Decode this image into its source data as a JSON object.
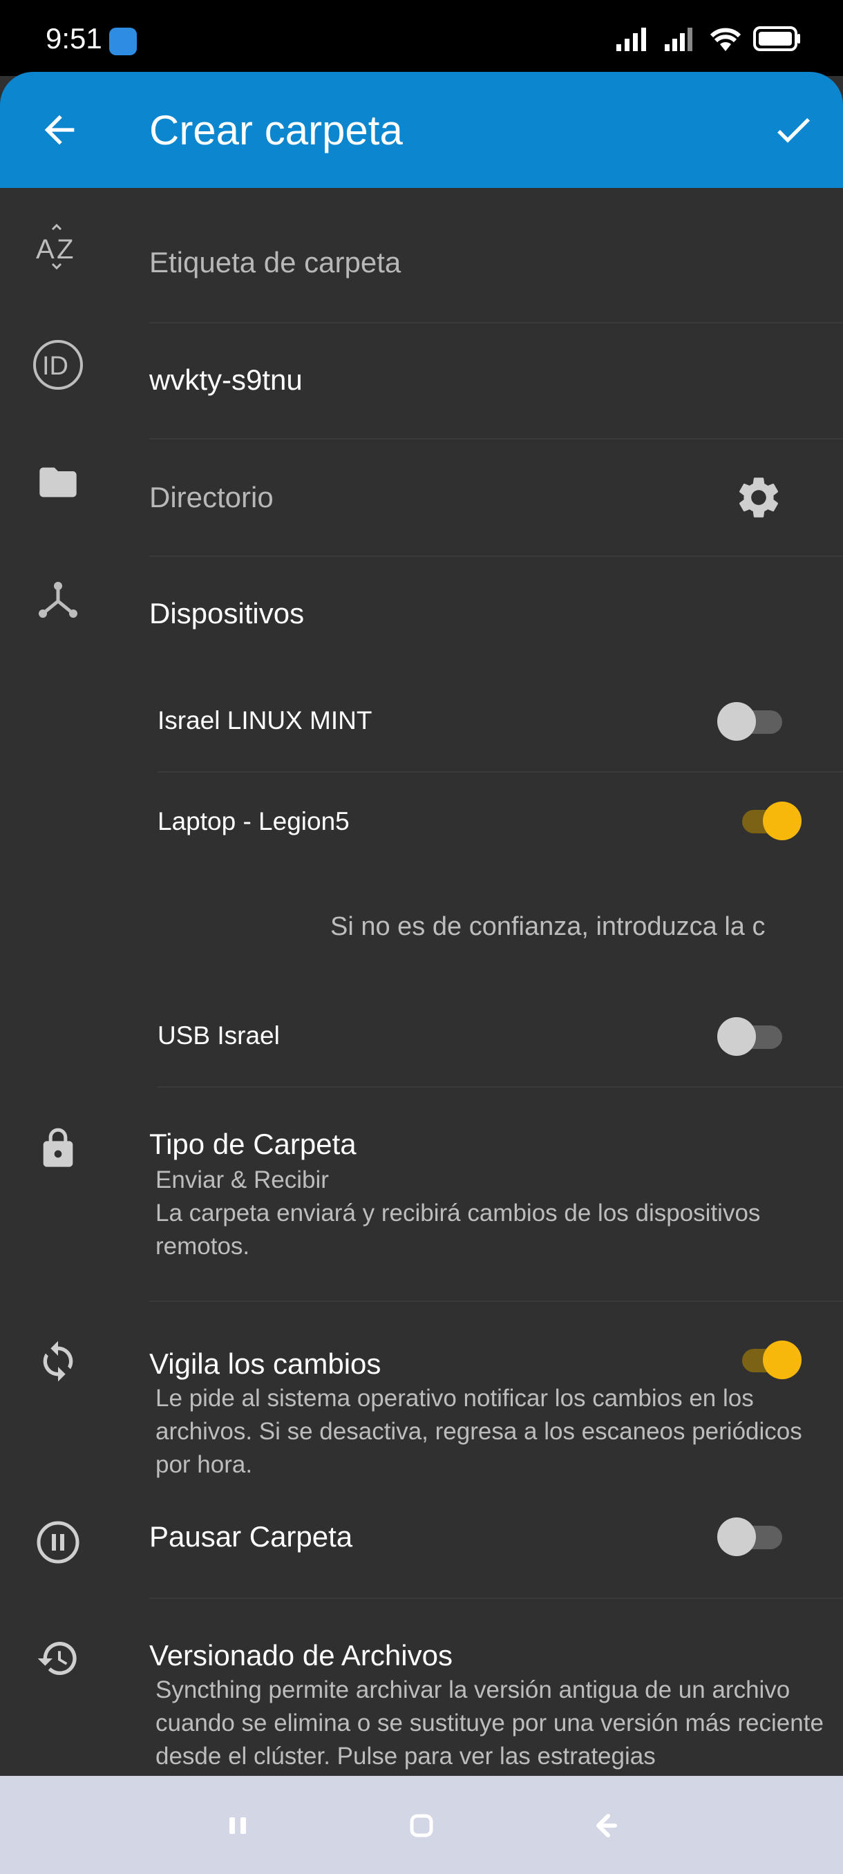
{
  "status_bar": {
    "time": "9:51"
  },
  "app_bar": {
    "title": "Crear carpeta"
  },
  "fields": {
    "label_placeholder": "Etiqueta de carpeta",
    "folder_id": "wvkty-s9tnu",
    "directory_placeholder": "Directorio",
    "devices_title": "Dispositivos"
  },
  "devices": [
    {
      "name": "Israel LINUX MINT",
      "enabled": false
    },
    {
      "name": "Laptop - Legion5",
      "enabled": true,
      "note": "Si no es de confianza, introduzca la c"
    },
    {
      "name": "USB Israel",
      "enabled": false
    }
  ],
  "folder_type": {
    "title": "Tipo de Carpeta",
    "value": "Enviar & Recibir",
    "description": "La carpeta enviará y recibirá cambios de los dispositivos remotos."
  },
  "watch_changes": {
    "title": "Vigila los cambios",
    "description": "Le pide al sistema operativo notificar los cambios en los archivos. Si se desactiva, regresa a los escaneos periódicos por hora.",
    "enabled": true
  },
  "pause_folder": {
    "title": "Pausar Carpeta",
    "enabled": false
  },
  "versioning": {
    "title": "Versionado de Archivos",
    "description": "Syncthing permite archivar la versión antigua de un archivo cuando se elimina o se sustituye por una versión más reciente desde el clúster. Pulse para ver las estrategias"
  },
  "icons": {
    "label": "sort-az-icon",
    "id": "id-icon",
    "directory": "folder-icon",
    "settings": "gear-icon",
    "devices": "share-icon",
    "folder_type": "lock-icon",
    "watch": "sync-icon",
    "pause": "pause-icon",
    "versioning": "history-icon"
  },
  "colors": {
    "app_bar": "#0b86cf",
    "background": "#303030",
    "toggle_on": "#f7b80b",
    "nav_bar": "#d2d6e5"
  }
}
